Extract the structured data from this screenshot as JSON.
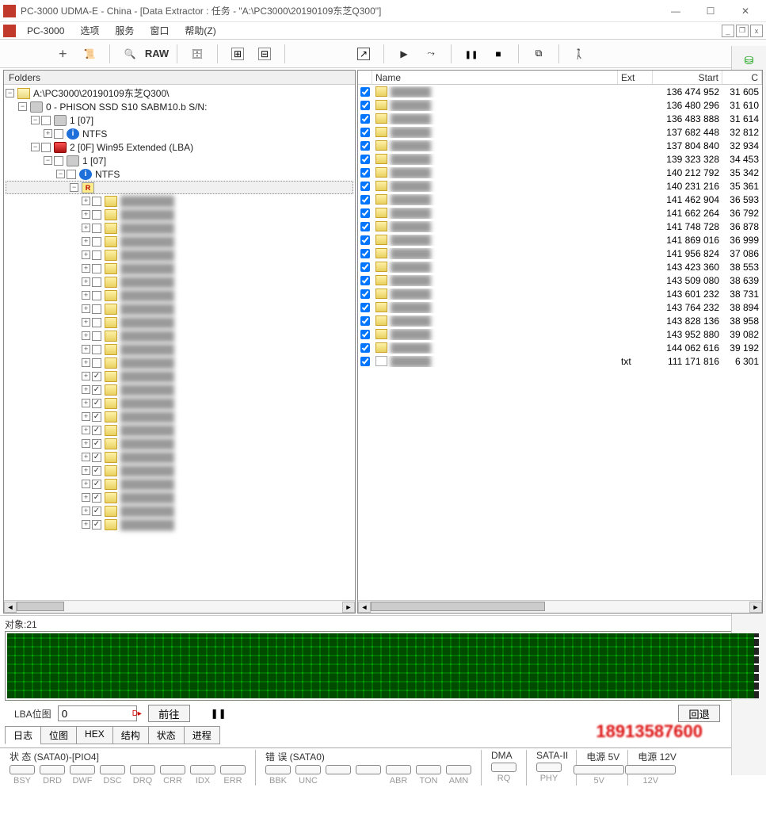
{
  "window": {
    "title": "PC-3000 UDMA-E - China - [Data Extractor : 任务 - \"A:\\PC3000\\20190109东芝Q300\"]"
  },
  "menu": {
    "app": "PC-3000",
    "items": [
      "选项",
      "服务",
      "窗口",
      "帮助(Z)"
    ]
  },
  "toolbar": {
    "raw_label": "RAW"
  },
  "left_panel": {
    "title": "Folders",
    "root": "A:\\PC3000\\20190109东芝Q300\\",
    "device": "0 - PHISON SSD S10 SABM10.b S/N:",
    "part1": "1 [07]",
    "ntfs": "NTFS",
    "part2": "2 [0F] Win95 Extended  (LBA)",
    "part1b": "1 [07]",
    "ntfs2": "NTFS",
    "folders_count": 25
  },
  "right_panel": {
    "columns": {
      "name": "Name",
      "ext": "Ext",
      "start": "Start",
      "c": "C"
    },
    "rows": [
      {
        "chk": true,
        "type": "folder",
        "name": "​",
        "ext": "",
        "start": "136 474 952",
        "c": "31 605"
      },
      {
        "chk": true,
        "type": "folder",
        "name": "​",
        "ext": "",
        "start": "136 480 296",
        "c": "31 610"
      },
      {
        "chk": true,
        "type": "folder",
        "name": "​",
        "ext": "",
        "start": "136 483 888",
        "c": "31 614"
      },
      {
        "chk": true,
        "type": "folder",
        "name": "​",
        "ext": "",
        "start": "137 682 448",
        "c": "32 812"
      },
      {
        "chk": true,
        "type": "folder",
        "name": "​",
        "ext": "",
        "start": "137 804 840",
        "c": "32 934"
      },
      {
        "chk": true,
        "type": "folder",
        "name": "​",
        "ext": "",
        "start": "139 323 328",
        "c": "34 453"
      },
      {
        "chk": true,
        "type": "folder",
        "name": "​",
        "ext": "",
        "start": "140 212 792",
        "c": "35 342"
      },
      {
        "chk": true,
        "type": "folder",
        "name": "​",
        "ext": "",
        "start": "140 231 216",
        "c": "35 361"
      },
      {
        "chk": true,
        "type": "folder",
        "name": "​",
        "ext": "",
        "start": "141 462 904",
        "c": "36 593"
      },
      {
        "chk": true,
        "type": "folder",
        "name": "​",
        "ext": "",
        "start": "141 662 264",
        "c": "36 792"
      },
      {
        "chk": true,
        "type": "folder",
        "name": "​",
        "ext": "",
        "start": "141 748 728",
        "c": "36 878"
      },
      {
        "chk": true,
        "type": "folder",
        "name": "​",
        "ext": "",
        "start": "141 869 016",
        "c": "36 999"
      },
      {
        "chk": true,
        "type": "folder",
        "name": "​",
        "ext": "",
        "start": "141 956 824",
        "c": "37 086"
      },
      {
        "chk": true,
        "type": "folder",
        "name": "​",
        "ext": "",
        "start": "143 423 360",
        "c": "38 553"
      },
      {
        "chk": true,
        "type": "folder",
        "name": "​",
        "ext": "",
        "start": "143 509 080",
        "c": "38 639"
      },
      {
        "chk": true,
        "type": "folder",
        "name": "​",
        "ext": "",
        "start": "143 601 232",
        "c": "38 731"
      },
      {
        "chk": true,
        "type": "folder",
        "name": "​",
        "ext": "",
        "start": "143 764 232",
        "c": "38 894"
      },
      {
        "chk": true,
        "type": "folder",
        "name": "​",
        "ext": "",
        "start": "143 828 136",
        "c": "38 958"
      },
      {
        "chk": true,
        "type": "folder",
        "name": "​",
        "ext": "",
        "start": "143 952 880",
        "c": "39 082"
      },
      {
        "chk": true,
        "type": "folder",
        "name": "​",
        "ext": "",
        "start": "144 062 616",
        "c": "39 192"
      },
      {
        "chk": true,
        "type": "file",
        "name": "0",
        "ext": "txt",
        "start": "111 171 816",
        "c": "6 301"
      }
    ]
  },
  "status_line": "对象:21",
  "bitmap": {
    "label": "LBA位图",
    "value": "0",
    "go": "前往",
    "back_text": "回退",
    "watermark_hint": "18913587600"
  },
  "tabs": [
    "日志",
    "位图",
    "HEX",
    "结构",
    "状态",
    "进程"
  ],
  "active_tab": 0,
  "footer": {
    "status_label": "状 态 (SATA0)-[PIO4]",
    "status_leds": [
      "BSY",
      "DRD",
      "DWF",
      "DSC",
      "DRQ",
      "CRR",
      "IDX",
      "ERR"
    ],
    "error_label": "错 误 (SATA0)",
    "error_leds": [
      "BBK",
      "UNC",
      "",
      "",
      "ABR",
      "TON",
      "AMN"
    ],
    "dma_label": "DMA",
    "dma_led": "RQ",
    "sata_label": "SATA-II",
    "sata_led": "PHY",
    "pwr5_label": "电源 5V",
    "pwr5_led": "5V",
    "pwr12_label": "电源 12V",
    "pwr12_led": "12V"
  }
}
